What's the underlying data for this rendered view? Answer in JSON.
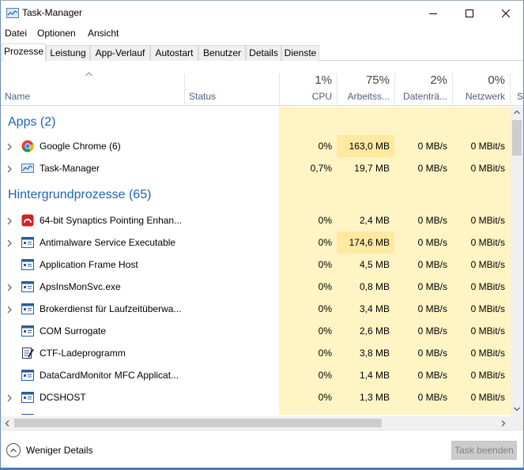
{
  "window": {
    "title": "Task-Manager"
  },
  "menu": [
    "Datei",
    "Optionen",
    "Ansicht"
  ],
  "tabs": [
    "Prozesse",
    "Leistung",
    "App-Verlauf",
    "Autostart",
    "Benutzer",
    "Details",
    "Dienste"
  ],
  "columns": {
    "name": "Name",
    "status": "Status",
    "cpu": {
      "pct": "1%",
      "label": "CPU"
    },
    "memory": {
      "pct": "75%",
      "label": "Arbeitss..."
    },
    "disk": {
      "pct": "2%",
      "label": "Datenträ..."
    },
    "network": {
      "pct": "0%",
      "label": "Netzwerk"
    },
    "extra": "St"
  },
  "groups": {
    "apps": "Apps (2)",
    "background": "Hintergrundprozesse (65)"
  },
  "apps": [
    {
      "name": "Google Chrome (6)",
      "icon": "chrome-icon",
      "cpu": "0%",
      "mem": "163,0 MB",
      "disk": "0 MB/s",
      "net": "0 MBit/s",
      "expandable": true
    },
    {
      "name": "Task-Manager",
      "icon": "task-manager-icon",
      "cpu": "0,7%",
      "mem": "19,7 MB",
      "disk": "0 MB/s",
      "net": "0 MBit/s",
      "expandable": true
    }
  ],
  "processes": [
    {
      "name": "64-bit Synaptics Pointing Enhan...",
      "icon": "synaptics-icon",
      "cpu": "0%",
      "mem": "2,4 MB",
      "disk": "0 MB/s",
      "net": "0 MBit/s",
      "expandable": true
    },
    {
      "name": "Antimalware Service Executable",
      "icon": "service-icon",
      "cpu": "0%",
      "mem": "174,6 MB",
      "disk": "0 MB/s",
      "net": "0 MBit/s",
      "expandable": true
    },
    {
      "name": "Application Frame Host",
      "icon": "service-icon",
      "cpu": "0%",
      "mem": "4,5 MB",
      "disk": "0 MB/s",
      "net": "0 MBit/s",
      "expandable": false
    },
    {
      "name": "ApsInsMonSvc.exe",
      "icon": "service-icon",
      "cpu": "0%",
      "mem": "0,8 MB",
      "disk": "0 MB/s",
      "net": "0 MBit/s",
      "expandable": true
    },
    {
      "name": "Brokerdienst für Laufzeitüberwa...",
      "icon": "service-icon",
      "cpu": "0%",
      "mem": "3,4 MB",
      "disk": "0 MB/s",
      "net": "0 MBit/s",
      "expandable": true
    },
    {
      "name": "COM Surrogate",
      "icon": "service-icon",
      "cpu": "0%",
      "mem": "2,6 MB",
      "disk": "0 MB/s",
      "net": "0 MBit/s",
      "expandable": false
    },
    {
      "name": "CTF-Ladeprogramm",
      "icon": "ctf-icon",
      "cpu": "0%",
      "mem": "3,8 MB",
      "disk": "0 MB/s",
      "net": "0 MBit/s",
      "expandable": false
    },
    {
      "name": "DataCardMonitor MFC Applicat...",
      "icon": "service-icon",
      "cpu": "0%",
      "mem": "1,4 MB",
      "disk": "0 MB/s",
      "net": "0 MBit/s",
      "expandable": false
    },
    {
      "name": "DCSHOST",
      "icon": "service-icon",
      "cpu": "0%",
      "mem": "1,3 MB",
      "disk": "0 MB/s",
      "net": "0 MBit/s",
      "expandable": true
    }
  ],
  "footer": {
    "fewer_details": "Weniger Details",
    "end_task": "Task beenden"
  },
  "colors": {
    "group_text": "#1e63b1",
    "col_light": "#fff4c4",
    "col_medium": "#ffe9a0"
  }
}
